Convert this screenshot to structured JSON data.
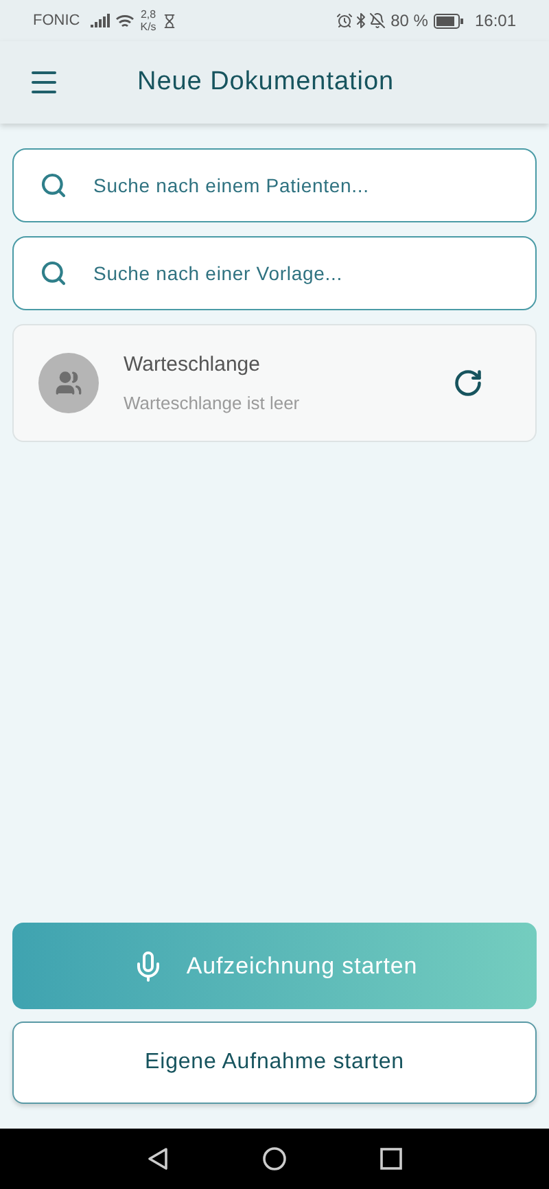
{
  "status_bar": {
    "carrier": "FONIC",
    "speed_value": "2,8",
    "speed_unit": "K/s",
    "battery": "80 %",
    "time": "16:01"
  },
  "header": {
    "title": "Neue Dokumentation"
  },
  "searches": [
    {
      "placeholder": "Suche nach einem Patienten..."
    },
    {
      "placeholder": "Suche nach einer Vorlage..."
    }
  ],
  "queue": {
    "title": "Warteschlange",
    "subtitle": "Warteschlange ist leer"
  },
  "buttons": [
    {
      "kind": "primary",
      "label": "Aufzeichnung starten"
    },
    {
      "kind": "secondary",
      "label": "Eigene Aufnahme starten"
    }
  ]
}
